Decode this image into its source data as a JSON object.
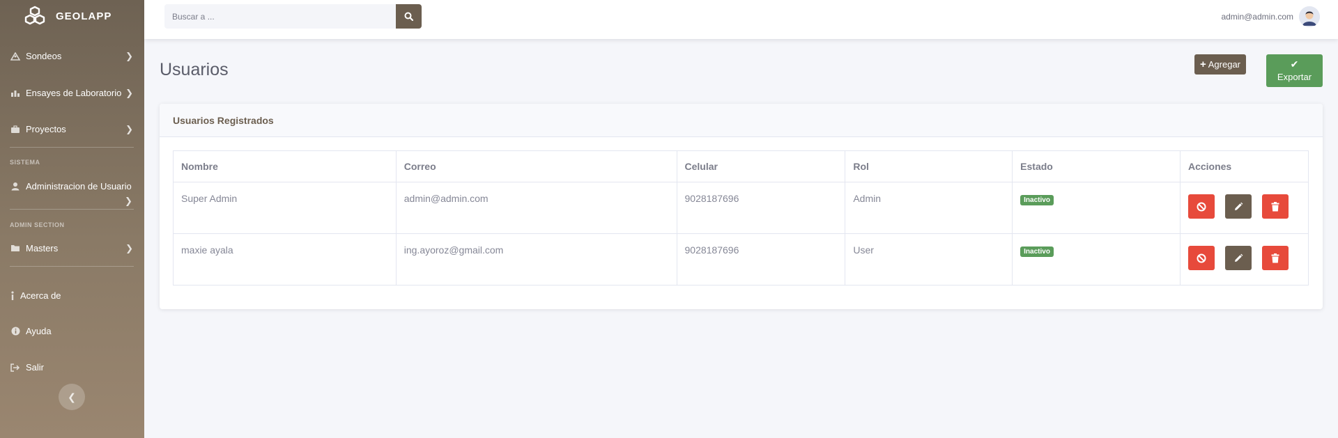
{
  "app": {
    "brand": "GEOLAPP"
  },
  "sidebar": {
    "items": [
      {
        "label": "Sondeos",
        "icon": "sondeo-icon"
      },
      {
        "label": "Ensayes de Laboratorio",
        "icon": "chart-icon"
      },
      {
        "label": "Proyectos",
        "icon": "briefcase-icon"
      }
    ],
    "section_sistema": "SISTEMA",
    "admin_usuario": "Administracion de Usuario",
    "section_admin": "ADMIN SECTION",
    "masters": "Masters",
    "acerca": "Acerca de",
    "ayuda": "Ayuda",
    "salir": "Salir"
  },
  "topbar": {
    "search_placeholder": "Buscar a ...",
    "user_email": "admin@admin.com"
  },
  "page": {
    "title": "Usuarios",
    "add_label": "Agregar",
    "export_label": "Exportar"
  },
  "card": {
    "title": "Usuarios Registrados",
    "columns": [
      "Nombre",
      "Correo",
      "Celular",
      "Rol",
      "Estado",
      "Acciones"
    ],
    "rows": [
      {
        "nombre": "Super Admin",
        "correo": "admin@admin.com",
        "celular": "9028187696",
        "rol": "Admin",
        "estado": "Inactivo"
      },
      {
        "nombre": "maxie ayala",
        "correo": "ing.ayoroz@gmail.com",
        "celular": "9028187696",
        "rol": "User",
        "estado": "Inactivo"
      }
    ]
  },
  "colors": {
    "sidebar_top": "#6e6253",
    "primary": "#6b5e4f",
    "success": "#5a9c5a",
    "danger": "#e74a3b"
  }
}
